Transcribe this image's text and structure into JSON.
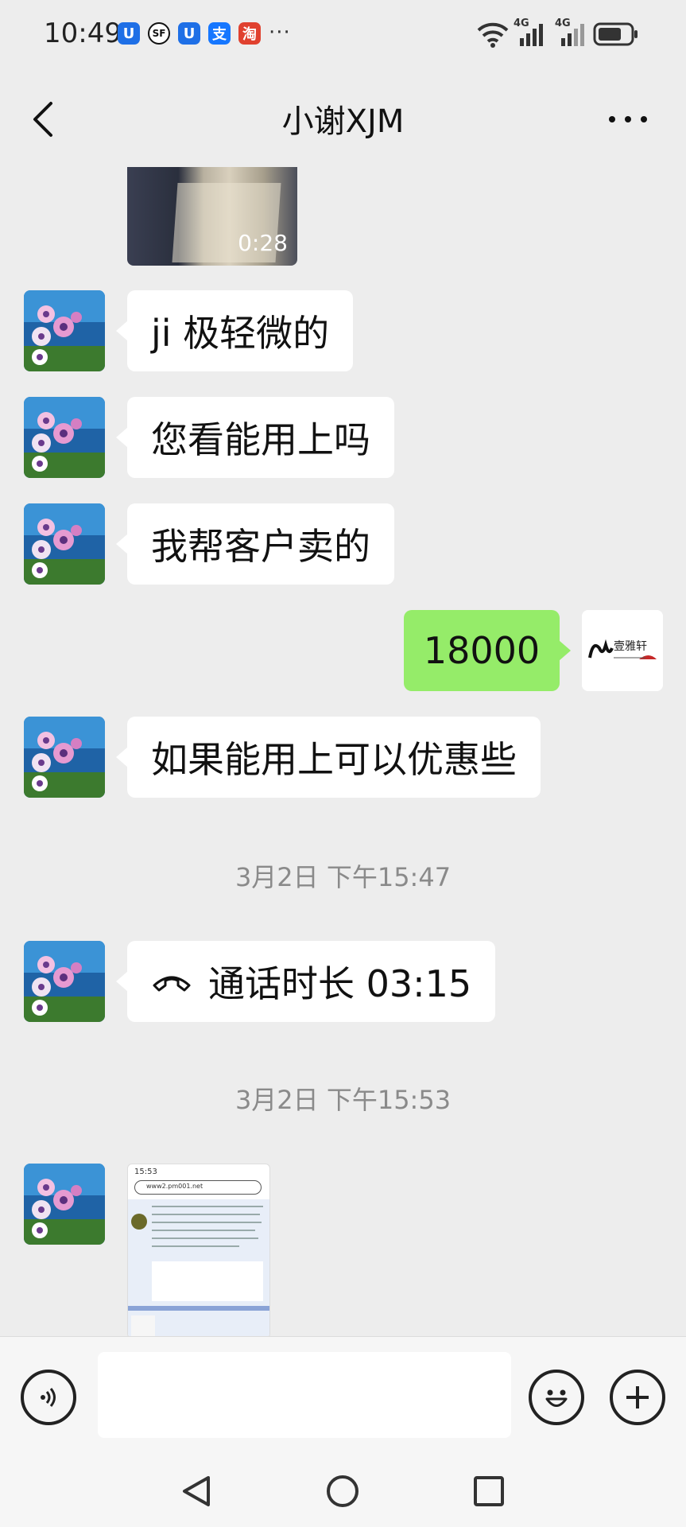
{
  "status_bar": {
    "time": "10:49",
    "app_badges": [
      {
        "name": "shield-app-icon",
        "glyph": "U",
        "color": "#1e6fe6"
      },
      {
        "name": "sf-express-icon",
        "glyph": "SF",
        "color": "#111111"
      },
      {
        "name": "shield-app-icon-2",
        "glyph": "U",
        "color": "#1e6fe6"
      },
      {
        "name": "alipay-icon",
        "glyph": "支",
        "color": "#1677ff"
      },
      {
        "name": "taobao-icon",
        "glyph": "淘",
        "color": "#e0412f"
      }
    ],
    "overflow": "···",
    "signal_1": "4G",
    "signal_2": "4G"
  },
  "header": {
    "title": "小谢XJM",
    "back_icon": "chevron-left-icon",
    "menu_icon": "more-dots-icon"
  },
  "messages": {
    "video": {
      "duration": "0:28"
    },
    "msg1": "ji 极轻微的",
    "msg2": "您看能用上吗",
    "msg3": "我帮客户卖的",
    "msg4_out": "18000",
    "msg5": "如果能用上可以优惠些",
    "timestamp1": "3月2日 下午15:47",
    "call": {
      "icon": "phone-hangup-icon",
      "text": "通话时长 03:15"
    },
    "timestamp2": "3月2日 下午15:53",
    "screenshot": {
      "time": "15:53",
      "url": "www2.pm001.net"
    }
  },
  "self_avatar": {
    "text": "壹雅轩"
  },
  "input_bar": {
    "voice_icon": "voice-icon",
    "emoji_icon": "emoji-icon",
    "plus_icon": "plus-icon"
  },
  "colors": {
    "background": "#ededed",
    "incoming_bubble": "#ffffff",
    "outgoing_bubble": "#95ec69",
    "timestamp": "#8a8a8a"
  }
}
